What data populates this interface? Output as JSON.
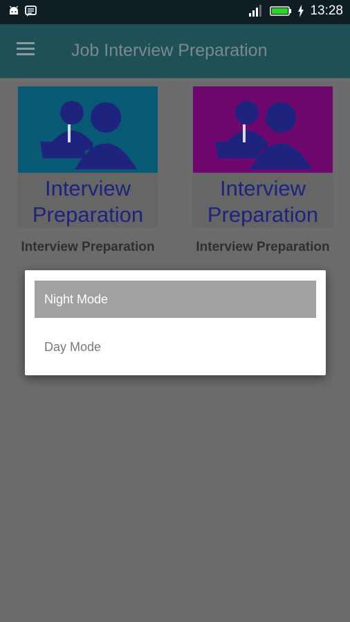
{
  "status_bar": {
    "time": "13:28",
    "icons": [
      "android-icon",
      "message-icon",
      "signal-icon",
      "battery-icon",
      "charging-icon"
    ]
  },
  "app_bar": {
    "title": "Job Interview Preparation",
    "menu_icon": "hamburger-menu-icon"
  },
  "cards": [
    {
      "big_text": "Interview Preparation",
      "caption": "Interview Preparation",
      "bg": "#085a74"
    },
    {
      "big_text": "Interview Preparation",
      "caption": "Interview Preparation",
      "bg": "#6e086e"
    }
  ],
  "dialog": {
    "options": [
      {
        "label": "Night Mode",
        "selected": true
      },
      {
        "label": "Day Mode",
        "selected": false
      }
    ]
  },
  "colors": {
    "app_bar": "#1f4f57",
    "status_bar": "#0e1e22",
    "overlay_bg": "#6b6b6b",
    "selected_option": "#a1a1a1",
    "figure": "#1e237e"
  }
}
